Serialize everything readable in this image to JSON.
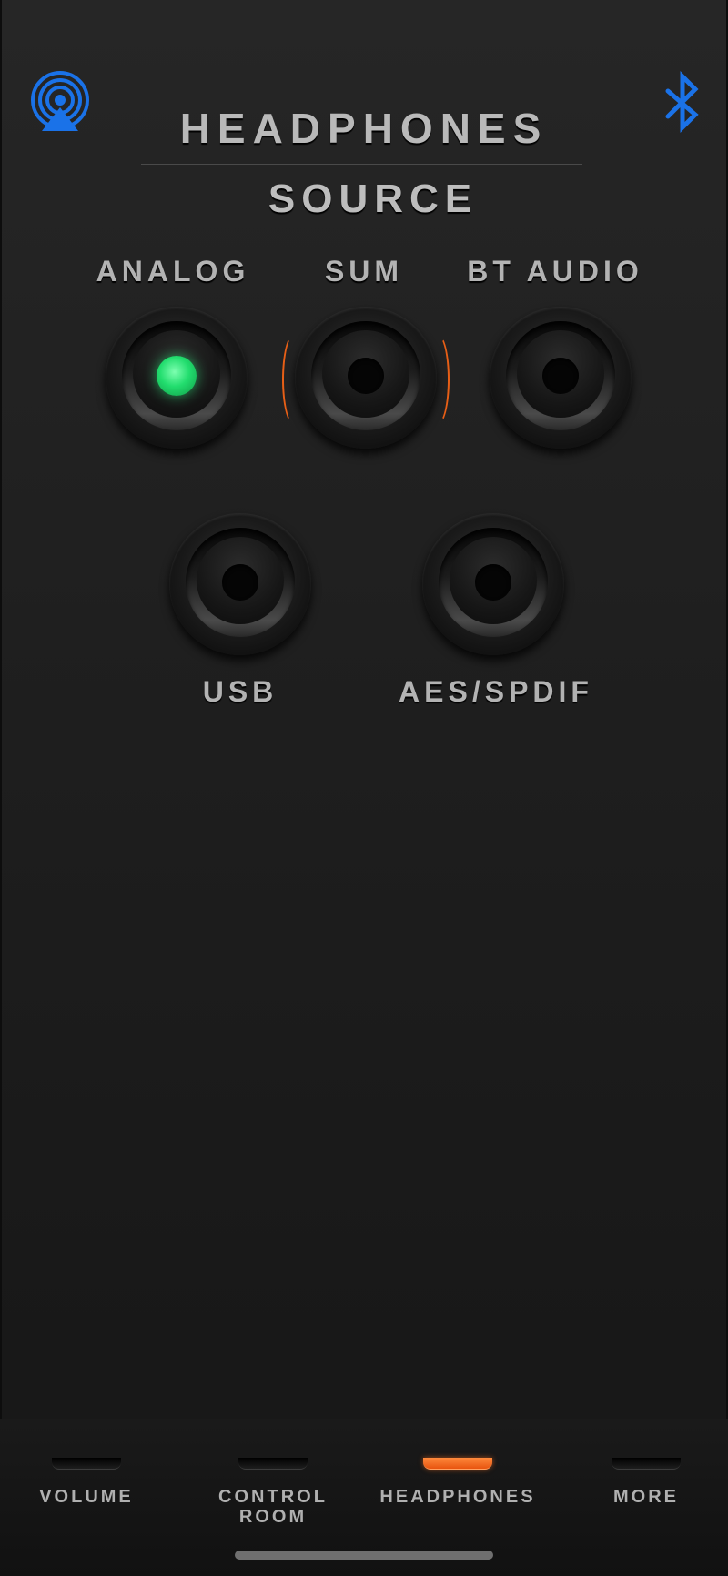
{
  "header": {
    "title": "HEADPHONES",
    "subtitle": "SOURCE",
    "airplay_icon": "airplay-icon",
    "bluetooth_icon": "bluetooth-icon"
  },
  "sources": [
    {
      "label": "ANALOG",
      "selected": true
    },
    {
      "label": "SUM",
      "selected": false,
      "highlighted": true
    },
    {
      "label": "BT AUDIO",
      "selected": false
    },
    {
      "label": "USB",
      "selected": false
    },
    {
      "label": "AES/SPDIF",
      "selected": false
    }
  ],
  "tabs": [
    {
      "label": "VOLUME",
      "active": false
    },
    {
      "label": "CONTROL\nROOM",
      "active": false
    },
    {
      "label": "HEADPHONES",
      "active": true
    },
    {
      "label": "MORE",
      "active": false
    }
  ],
  "colors": {
    "accent_blue": "#1a72e8",
    "led_green": "#22dd6e",
    "active_orange": "#e8540f",
    "text_gray": "#b3b3b3"
  }
}
